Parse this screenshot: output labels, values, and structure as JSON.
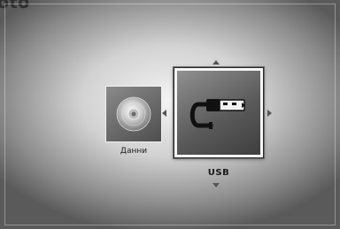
{
  "header": {
    "title": "oto"
  },
  "menu": {
    "items": [
      {
        "label": "Данни",
        "icon": "disc-icon",
        "selected": false
      },
      {
        "label": "USB",
        "icon": "usb-icon",
        "selected": true
      }
    ]
  },
  "colors": {
    "background_center": "#f4f4f4",
    "background_edge": "#5a5a5a",
    "tile": "#5b5b5b",
    "highlight_border": "#f6f6f6"
  }
}
